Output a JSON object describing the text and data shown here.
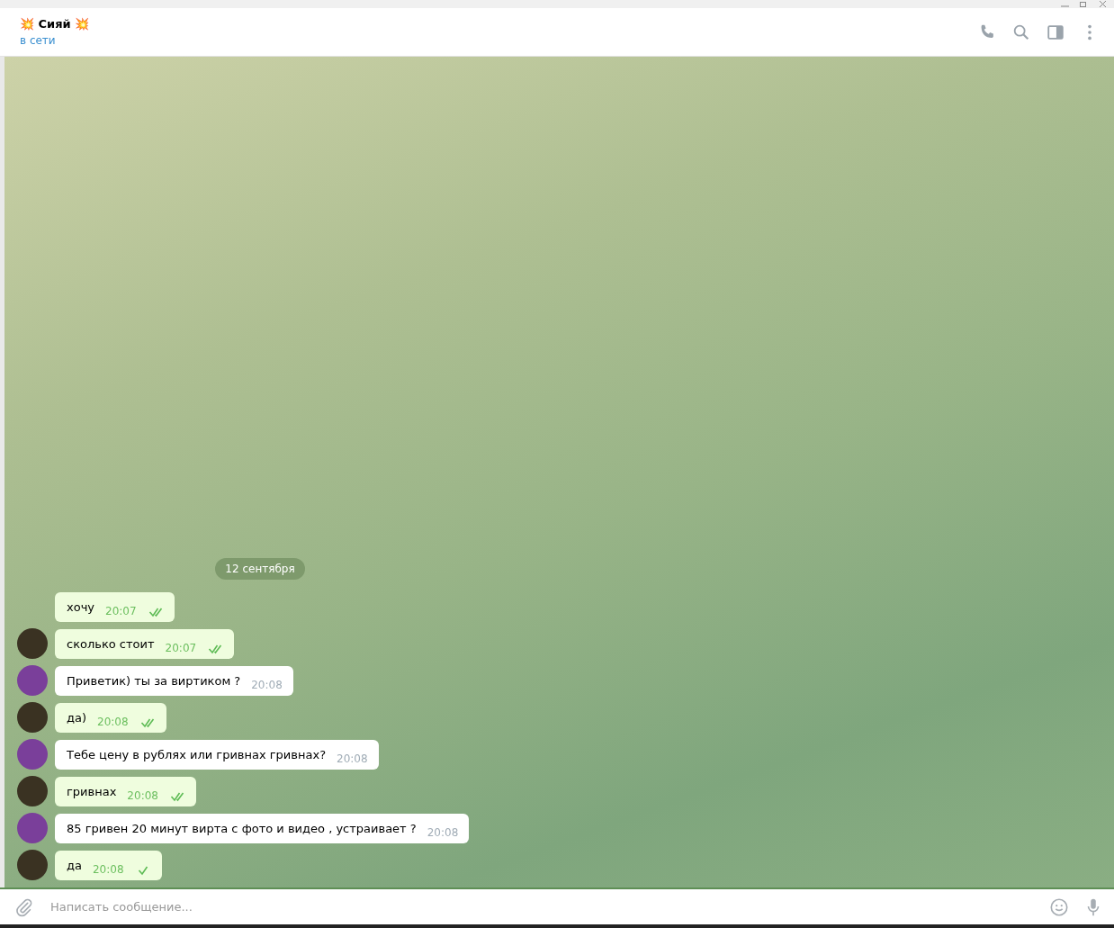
{
  "header": {
    "title": "💥 Сияй 💥",
    "status": "в сети"
  },
  "date_badge": "12 сентября",
  "messages": [
    {
      "kind": "outgoing",
      "text": "хочу",
      "time": "20:07",
      "read": true,
      "avatar": false
    },
    {
      "kind": "outgoing",
      "text": "сколько стоит",
      "time": "20:07",
      "read": true,
      "avatar": true
    },
    {
      "kind": "incoming",
      "text": "Приветик) ты за виртиком ?",
      "time": "20:08",
      "avatar": true
    },
    {
      "kind": "outgoing",
      "text": "да)",
      "time": "20:08",
      "read": true,
      "avatar": true
    },
    {
      "kind": "incoming",
      "text": "Тебе цену в рублях или гривнах гривнах?",
      "time": "20:08",
      "avatar": true
    },
    {
      "kind": "outgoing",
      "text": "гривнах",
      "time": "20:08",
      "read": true,
      "avatar": true
    },
    {
      "kind": "incoming",
      "text": "85 гривен 20 минут вирта с фото и видео , устраивает ?",
      "time": "20:08",
      "avatar": true
    },
    {
      "kind": "outgoing",
      "text": "да",
      "time": "20:08",
      "read": false,
      "avatar": true
    }
  ],
  "composer": {
    "placeholder": "Написать сообщение..."
  }
}
